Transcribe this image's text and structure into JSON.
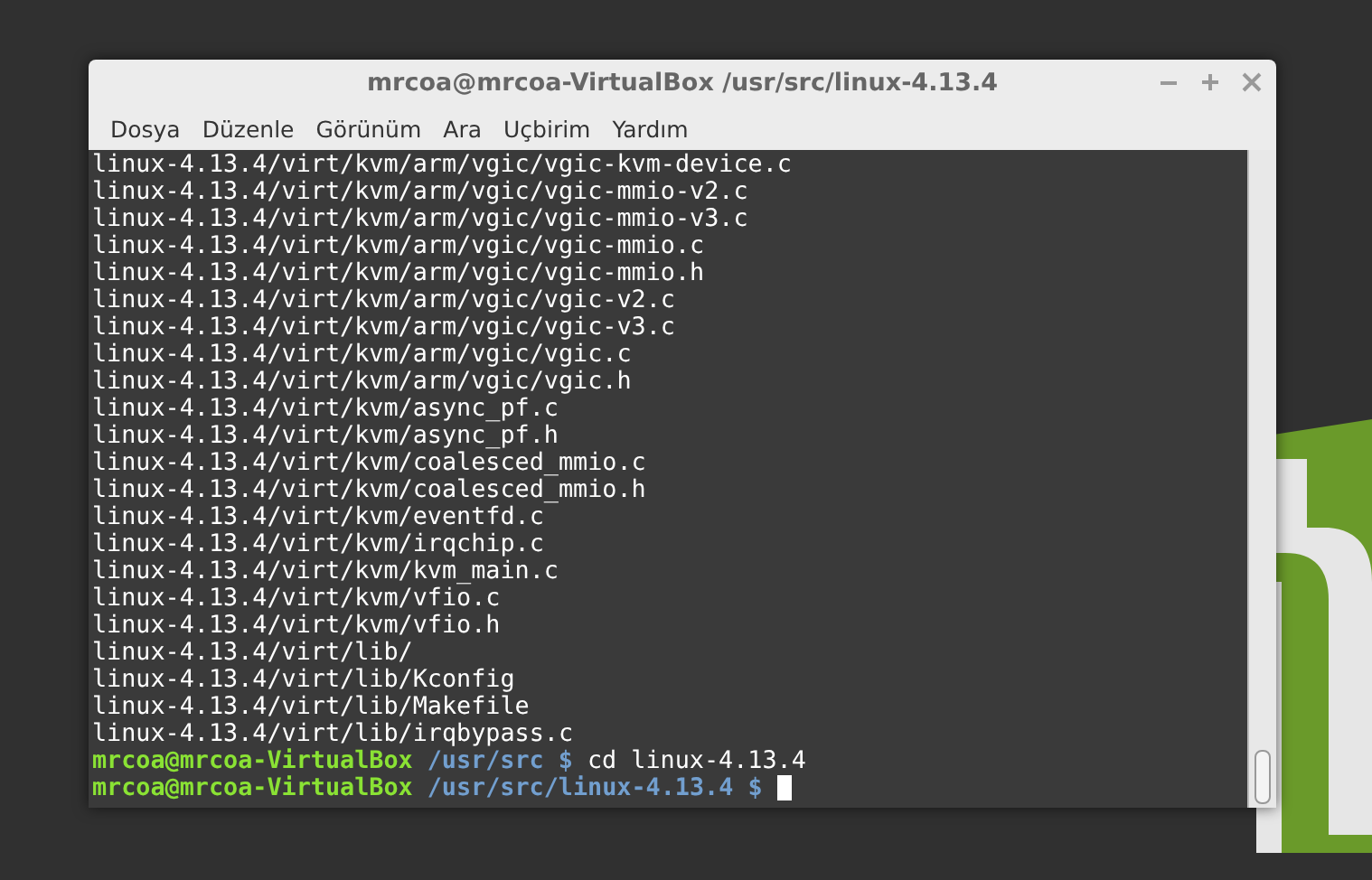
{
  "window": {
    "title": "mrcoa@mrcoa-VirtualBox /usr/src/linux-4.13.4"
  },
  "menu": [
    "Dosya",
    "Düzenle",
    "Görünüm",
    "Ara",
    "Uçbirim",
    "Yardım"
  ],
  "terminal": {
    "output": [
      "linux-4.13.4/virt/kvm/arm/vgic/vgic-kvm-device.c",
      "linux-4.13.4/virt/kvm/arm/vgic/vgic-mmio-v2.c",
      "linux-4.13.4/virt/kvm/arm/vgic/vgic-mmio-v3.c",
      "linux-4.13.4/virt/kvm/arm/vgic/vgic-mmio.c",
      "linux-4.13.4/virt/kvm/arm/vgic/vgic-mmio.h",
      "linux-4.13.4/virt/kvm/arm/vgic/vgic-v2.c",
      "linux-4.13.4/virt/kvm/arm/vgic/vgic-v3.c",
      "linux-4.13.4/virt/kvm/arm/vgic/vgic.c",
      "linux-4.13.4/virt/kvm/arm/vgic/vgic.h",
      "linux-4.13.4/virt/kvm/async_pf.c",
      "linux-4.13.4/virt/kvm/async_pf.h",
      "linux-4.13.4/virt/kvm/coalesced_mmio.c",
      "linux-4.13.4/virt/kvm/coalesced_mmio.h",
      "linux-4.13.4/virt/kvm/eventfd.c",
      "linux-4.13.4/virt/kvm/irqchip.c",
      "linux-4.13.4/virt/kvm/kvm_main.c",
      "linux-4.13.4/virt/kvm/vfio.c",
      "linux-4.13.4/virt/kvm/vfio.h",
      "linux-4.13.4/virt/lib/",
      "linux-4.13.4/virt/lib/Kconfig",
      "linux-4.13.4/virt/lib/Makefile",
      "linux-4.13.4/virt/lib/irqbypass.c"
    ],
    "prompts": [
      {
        "user": "mrcoa@mrcoa-VirtualBox",
        "path": "/usr/src",
        "symbol": "$",
        "command": "cd linux-4.13.4",
        "cursor": false
      },
      {
        "user": "mrcoa@mrcoa-VirtualBox",
        "path": "/usr/src/linux-4.13.4",
        "symbol": "$",
        "cursor": true
      }
    ]
  }
}
